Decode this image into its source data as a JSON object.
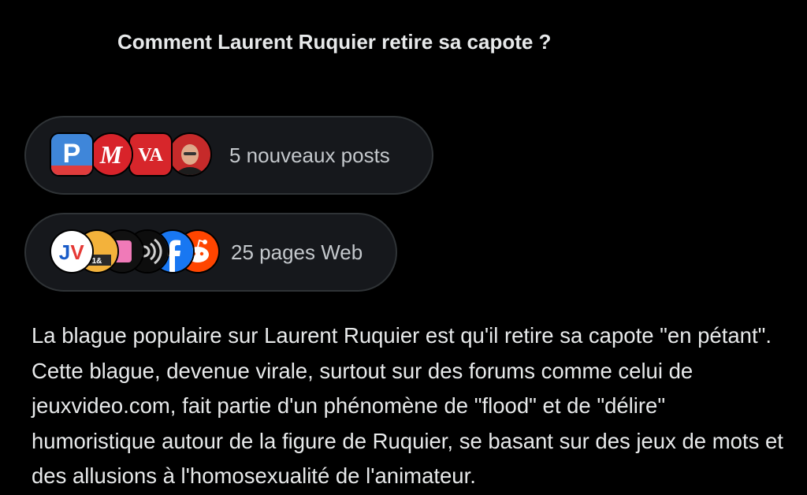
{
  "question": "Comment Laurent Ruquier retire sa capote ?",
  "sources": {
    "posts": {
      "label": "5 nouveaux posts",
      "avatars": [
        "parisien-logo",
        "marianne-logo",
        "valeurs-actuelles-logo",
        "person-photo"
      ]
    },
    "web": {
      "label": "25 pages Web",
      "avatars": [
        "jv-logo",
        "site-logo",
        "pink-logo",
        "audio-logo",
        "facebook-logo",
        "reddit-logo"
      ]
    }
  },
  "answer": "La blague populaire sur Laurent Ruquier est qu'il retire sa capote \"en pétant\". Cette blague, devenue virale, surtout sur des forums comme celui de jeuxvideo.com, fait partie d'un phénomène de \"flood\" et de \"délire\" humoristique autour de la figure de Ruquier, se basant sur des jeux de mots et des allusions à l'homosexualité de l'animateur.",
  "colors": {
    "background": "#000000",
    "pill_background": "#16181c",
    "pill_border": "#2f3336",
    "text": "#e7e9ea",
    "muted_text": "#c4c8cc"
  }
}
